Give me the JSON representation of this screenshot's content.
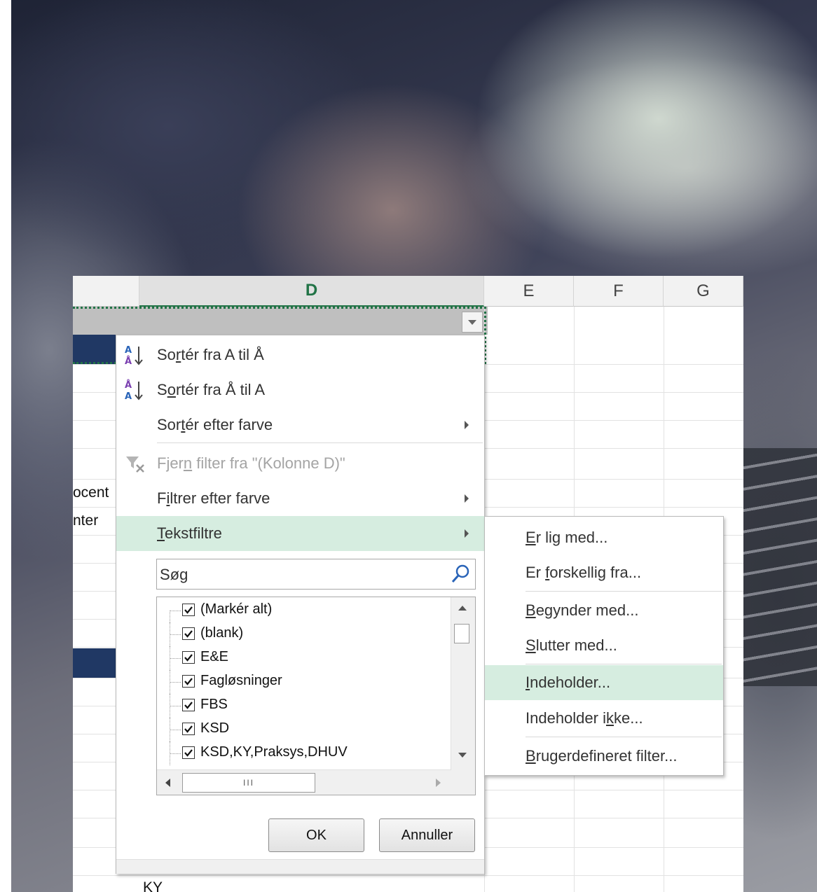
{
  "columns": [
    {
      "letter": "D",
      "selected": true
    },
    {
      "letter": "E",
      "selected": false
    },
    {
      "letter": "F",
      "selected": false
    },
    {
      "letter": "G",
      "selected": false
    }
  ],
  "cells": {
    "row_text_1": "ocent",
    "row_text_2": "nter",
    "bottom_cell": "KY"
  },
  "menu": {
    "sort_az": {
      "pre": "So",
      "key": "r",
      "post": "tér fra A til Å"
    },
    "sort_za": {
      "pre": "S",
      "key": "o",
      "post": "rtér fra Å til A"
    },
    "sort_color": {
      "pre": "Sor",
      "key": "t",
      "post": "ér efter farve"
    },
    "clear_filter": {
      "pre": "Fjer",
      "key": "n",
      "post": " filter fra \"(Kolonne D)\""
    },
    "filter_color": {
      "pre": "F",
      "key": "i",
      "post": "ltrer efter farve"
    },
    "text_filters": {
      "pre": "",
      "key": "T",
      "post": "ekstfiltre"
    }
  },
  "search": {
    "placeholder": "Søg"
  },
  "list_items": [
    {
      "label": "(Markér alt)",
      "checked": true
    },
    {
      "label": "(blank)",
      "checked": true
    },
    {
      "label": "E&E",
      "checked": true
    },
    {
      "label": "Fagløsninger",
      "checked": true
    },
    {
      "label": "FBS",
      "checked": true
    },
    {
      "label": "KSD",
      "checked": true
    },
    {
      "label": "KSD,KY,Praksys,DHUV",
      "checked": true
    }
  ],
  "scroll_thumb_label": "III",
  "buttons": {
    "ok": "OK",
    "cancel": "Annuller"
  },
  "submenu": [
    {
      "pre": "",
      "key": "E",
      "post": "r lig med..."
    },
    {
      "pre": "Er ",
      "key": "f",
      "post": "orskellig fra..."
    },
    {
      "pre": "",
      "key": "B",
      "post": "egynder med..."
    },
    {
      "pre": "",
      "key": "S",
      "post": "lutter med..."
    },
    {
      "pre": "",
      "key": "I",
      "post": "ndeholder..."
    },
    {
      "pre": "Indeholder i",
      "key": "k",
      "post": "ke..."
    },
    {
      "pre": "",
      "key": "B",
      "post": "rugerdefineret filter..."
    }
  ],
  "colors": {
    "accent": "#217346",
    "highlight": "#d6ede0",
    "navy": "#203864"
  }
}
